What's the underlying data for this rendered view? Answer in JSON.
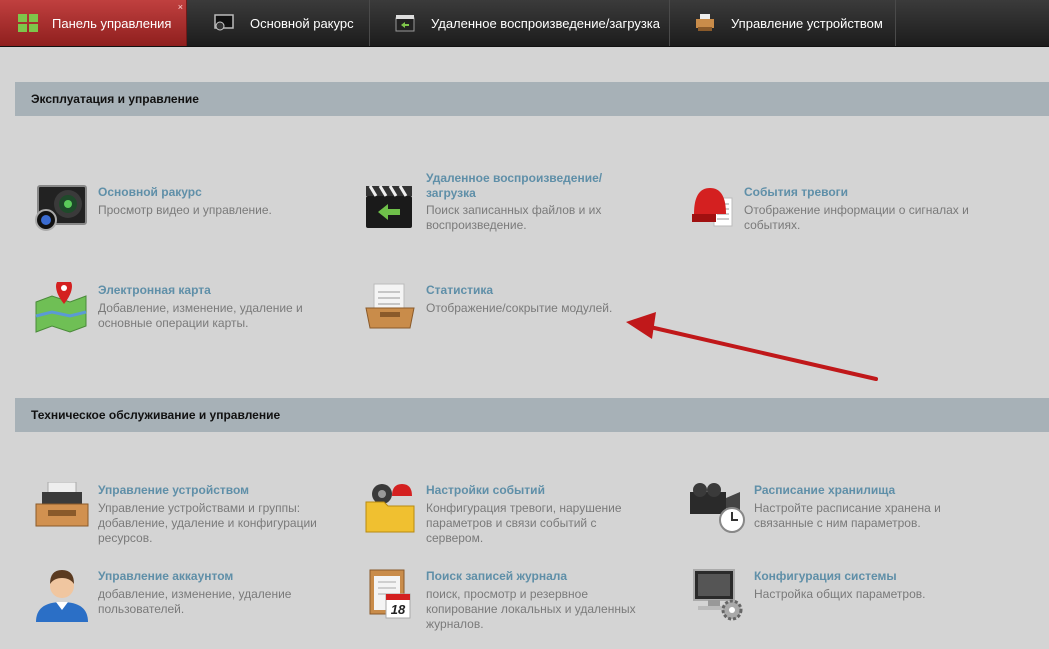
{
  "tabs": [
    {
      "label": "Панель управления",
      "active": true
    },
    {
      "label": "Основной ракурс"
    },
    {
      "label": "Удаленное воспроизведение/загрузка"
    },
    {
      "label": "Управление устройством"
    }
  ],
  "close_glyph": "×",
  "sections": [
    {
      "title": "Эксплуатация и управление",
      "items": [
        {
          "title": "Основной ракурс",
          "desc": "Просмотр видео и управление.",
          "icon": "monitor-camera-icon"
        },
        {
          "title": "Удаленное воспроизведение/ загрузка",
          "desc": "Поиск записанных файлов и их воспроизведение.",
          "icon": "clapper-icon"
        },
        {
          "title": "События тревоги",
          "desc": "Отображение информации о сигналах и событиях.",
          "icon": "alarm-siren-icon"
        },
        {
          "title": "Электронная карта",
          "desc": "Добавление, изменение, удаление и основные операции карты.",
          "icon": "map-pin-icon"
        },
        {
          "title": "Статистика",
          "desc": "Отображение/сокрытие модулей.",
          "icon": "statistics-tray-icon"
        }
      ]
    },
    {
      "title": "Техническое обслуживание и управление",
      "items": [
        {
          "title": "Управление устройством",
          "desc": "Управление устройствами и группы: добавление, удаление и конфигурации ресурсов.",
          "icon": "device-printer-icon"
        },
        {
          "title": "Настройки событий",
          "desc": "Конфигурация тревоги, нарушение параметров и связи событий с сервером.",
          "icon": "event-folder-icon"
        },
        {
          "title": "Расписание хранилища",
          "desc": "Настройте расписание хранена и связанные с ним параметров.",
          "icon": "camera-clock-icon"
        },
        {
          "title": "Управление аккаунтом",
          "desc": "добавление, изменение, удаление пользователей.",
          "icon": "user-icon"
        },
        {
          "title": "Поиск записей журнала",
          "desc": "поиск, просмотр и резервное копирование локальных и удаленных журналов.",
          "icon": "log-calendar-icon"
        },
        {
          "title": "Конфигурация системы",
          "desc": "Настройка общих параметров.",
          "icon": "system-monitor-gear-icon"
        }
      ]
    }
  ],
  "calendar_day": "18",
  "colors": {
    "accent_tab": "#b33a39",
    "link": "#5f8fa8",
    "section_bg": "#a7b1b7",
    "arrow": "#c0181a"
  }
}
